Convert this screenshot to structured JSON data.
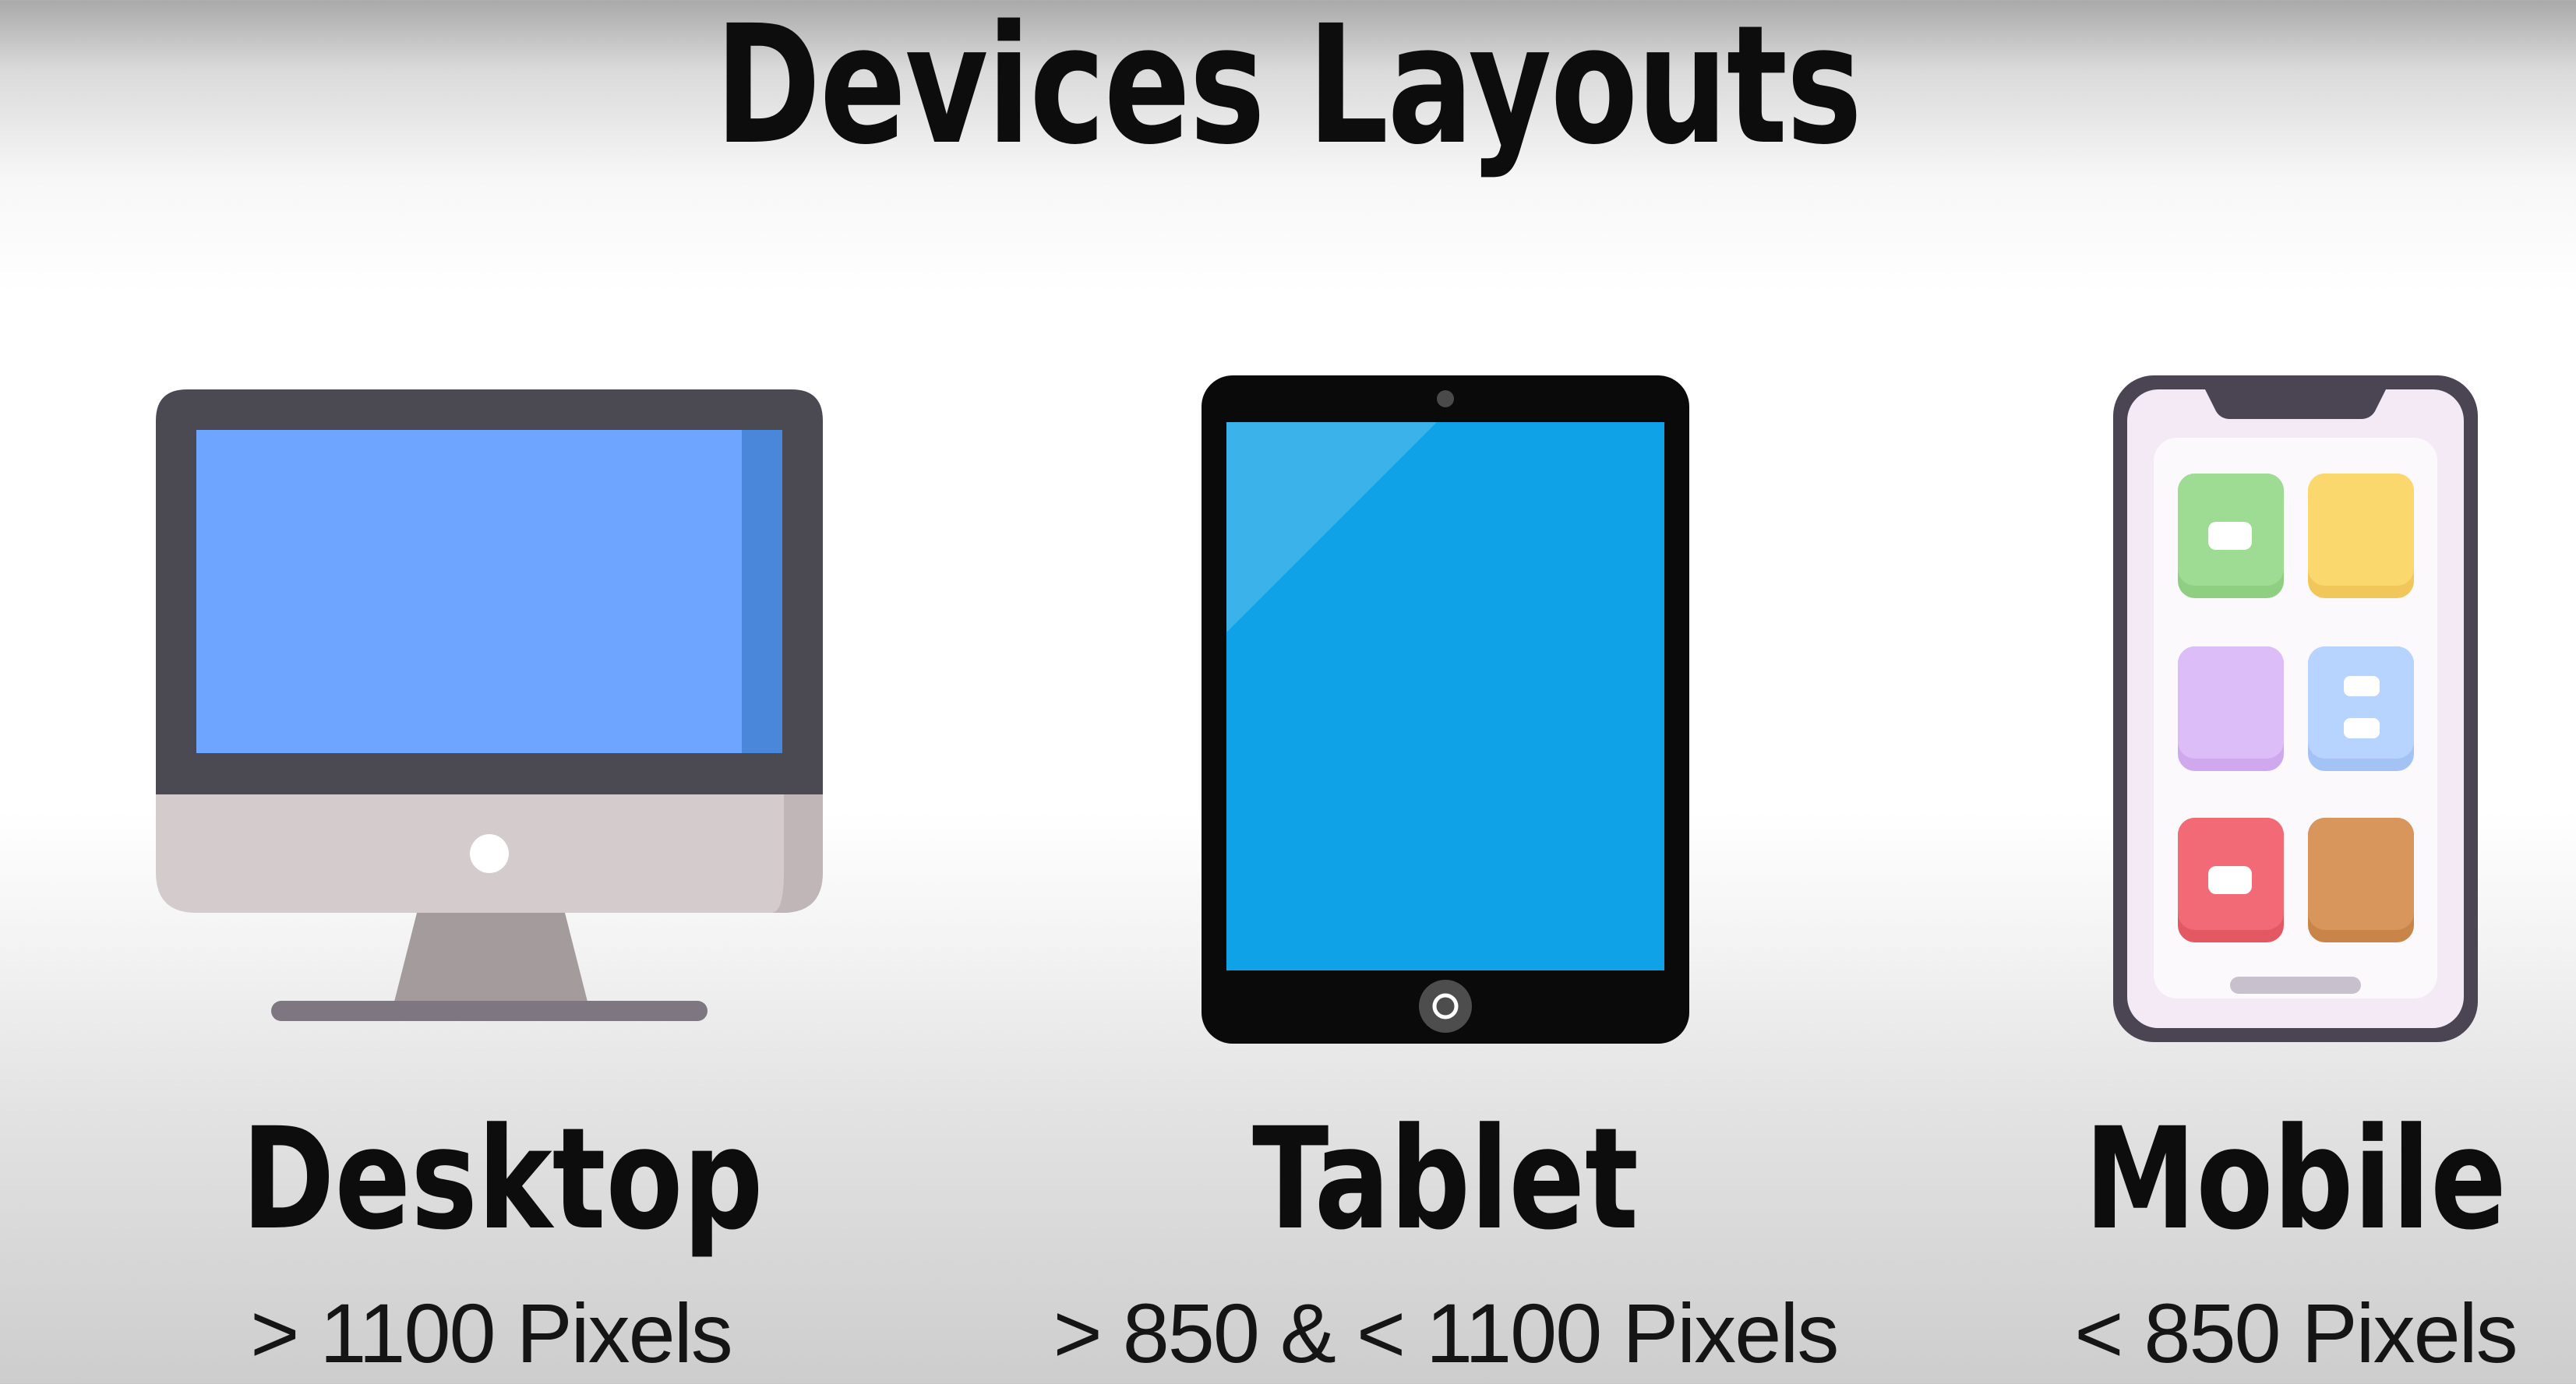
{
  "slide": {
    "title": "Devices Layouts"
  },
  "devices": [
    {
      "name": "Desktop",
      "range": "> 1100 Pixels",
      "icon": "desktop-monitor-icon"
    },
    {
      "name": "Tablet",
      "range": "> 850 & < 1100  Pixels",
      "icon": "tablet-icon"
    },
    {
      "name": "Mobile",
      "range": "< 850 Pixels",
      "icon": "smartphone-icon"
    }
  ],
  "colors": {
    "desktop_screen": "#6ea6ff",
    "desktop_bezel": "#4b4a52",
    "desktop_chin": "#d3cbcc",
    "tablet_screen": "#0fa2e6",
    "tablet_body": "#0a0a0a",
    "phone_frame": "#4b4453",
    "phone_screen": "#f3eaf6",
    "app_green": "#8fcf82",
    "app_yellow": "#fbd86e",
    "app_lavender": "#dcbdf7",
    "app_blue": "#b7d3ff",
    "app_red": "#f26a75",
    "app_brown": "#d8955c"
  }
}
